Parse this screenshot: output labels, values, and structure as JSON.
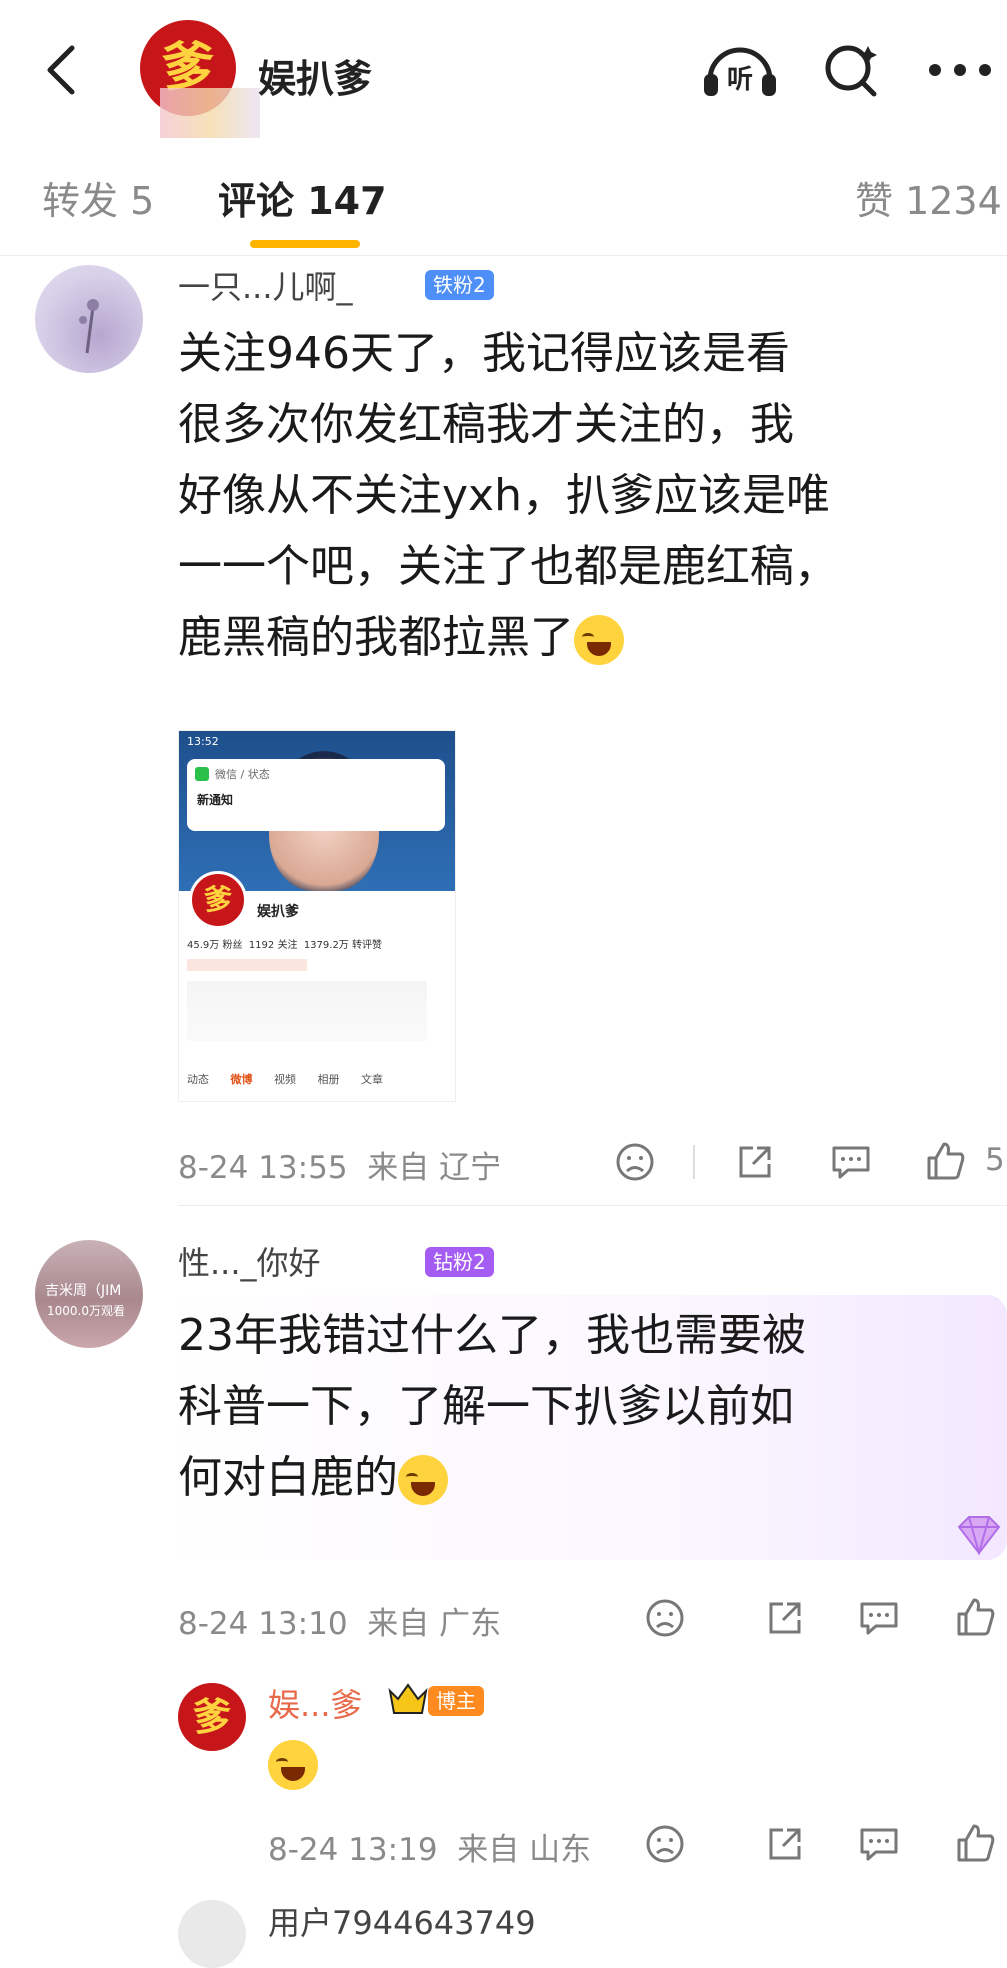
{
  "header": {
    "title": "娱扒爹",
    "avatar_char": "爹",
    "icons": [
      "back-icon",
      "listen-icon",
      "search-icon",
      "more-icon"
    ],
    "listen_label": "听"
  },
  "tabs": {
    "repost": "转发 5",
    "comments": "评论 147",
    "likes": "赞 1234"
  },
  "comments": [
    {
      "username": "一只...儿啊_",
      "badge": "铁粉2",
      "badge_color": "#4d8ff7",
      "text_lines": [
        "关注946天了，我记得应该是看",
        "很多次你发红稿我才关注的，我",
        "好像从不关注yxh，扒爹应该是唯",
        "一一个吧，关注了也都是鹿红稿，",
        "鹿黑稿的我都拉黑了"
      ],
      "time": "8-24 13:55",
      "location": "来自 辽宁",
      "like_count": "5",
      "screenshot": {
        "status_time": "13:52",
        "popup_app": "微信 / 状态",
        "popup_text": "新通知",
        "profile_name": "娱扒爹",
        "stats": [
          "45.9万 粉丝",
          "1192 关注",
          "1379.2万 转评赞"
        ],
        "tabs": [
          "动态",
          "微博",
          "视频",
          "相册",
          "文章"
        ]
      }
    },
    {
      "username": "性..._你好",
      "badge": "钻粉2",
      "badge_color": "#a45cf2",
      "avatar_text": "吉米周（JIM",
      "avatar_sub": "1000.0万观看",
      "text_lines": [
        "23年我错过什么了，我也需要被",
        "科普一下，了解一下扒爹以前如",
        "何对白鹿的"
      ],
      "time": "8-24 13:10",
      "location": "来自 广东"
    },
    {
      "username": "娱...爹",
      "badge": "博主",
      "badge_color": "#ff8a1f",
      "time": "8-24 13:19",
      "location": "来自 山东"
    },
    {
      "username": "用户7944643749"
    }
  ],
  "colors": {
    "accent": "#ffb400",
    "brand_red": "#c6161a"
  }
}
